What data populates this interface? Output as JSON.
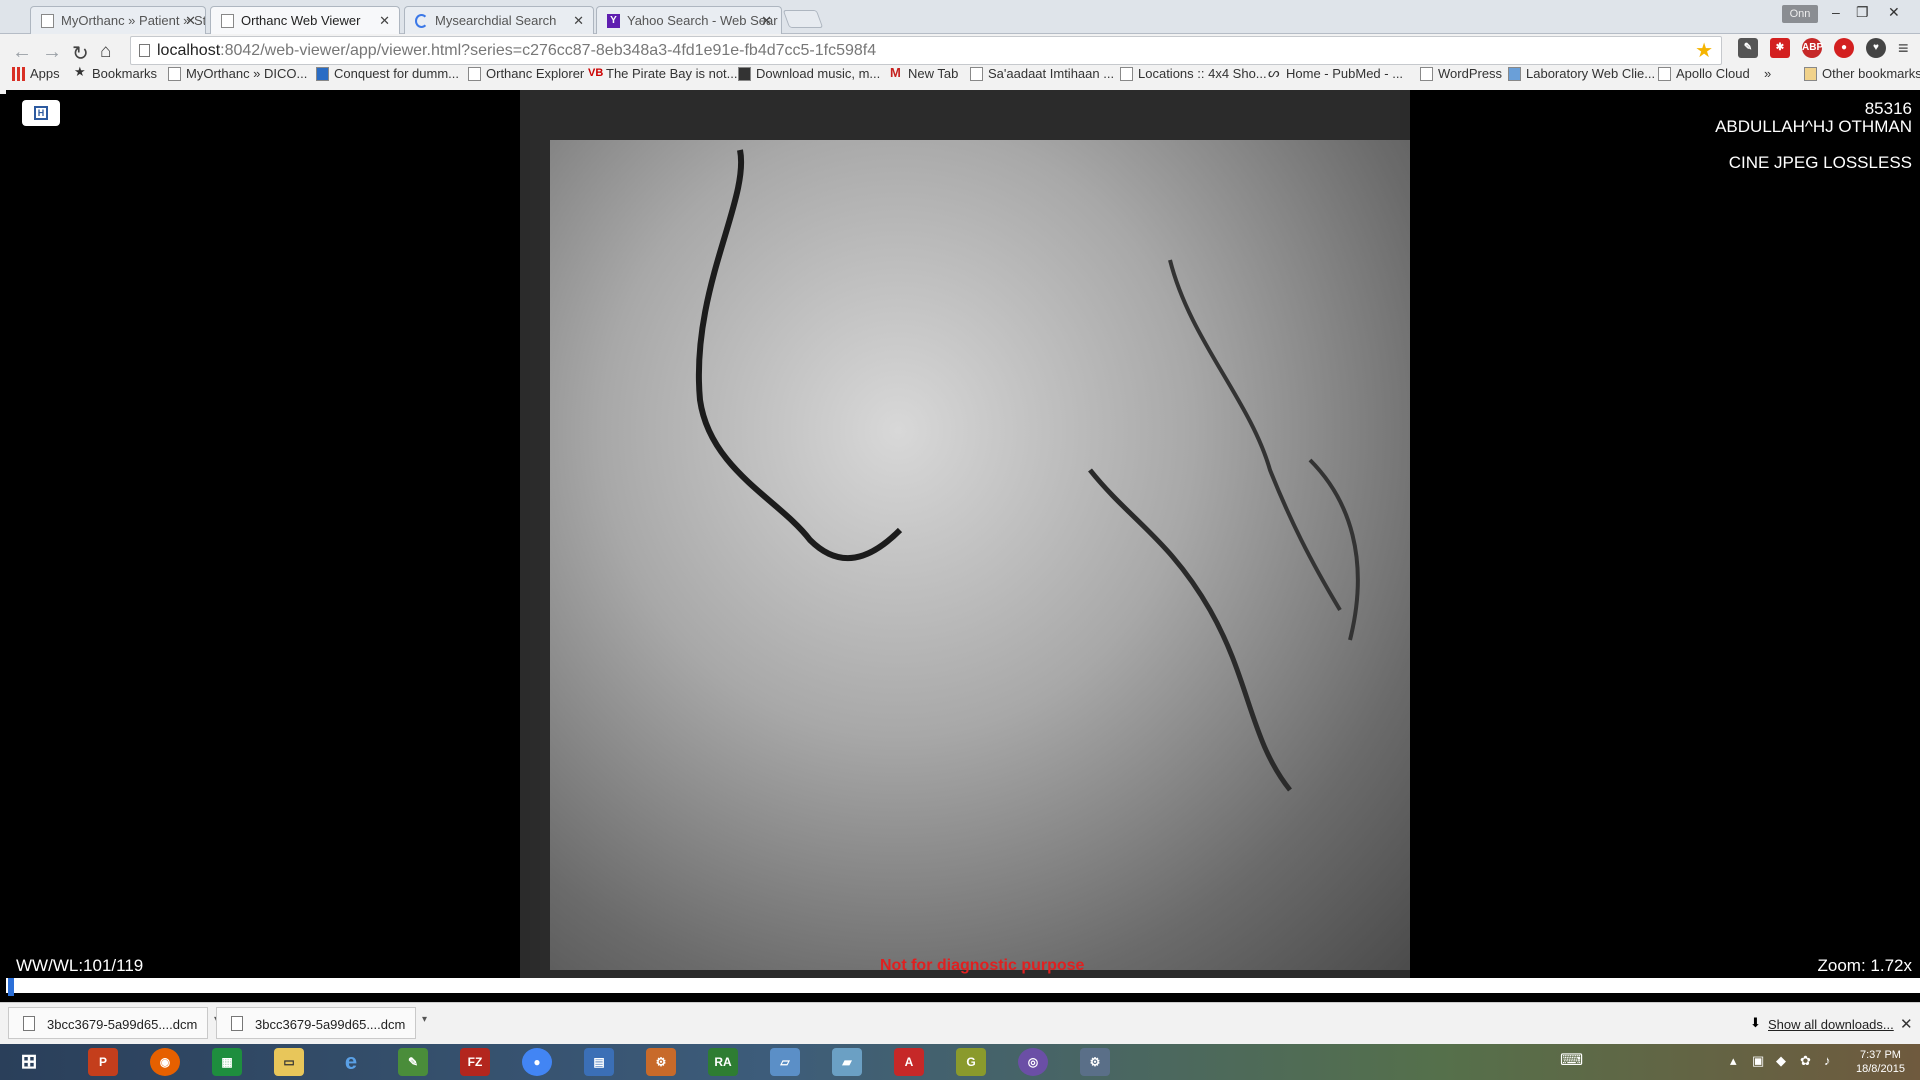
{
  "tabs": [
    {
      "label": "MyOrthanc » Patient » Stu",
      "active": false
    },
    {
      "label": "Orthanc Web Viewer",
      "active": true
    },
    {
      "label": "Mysearchdial Search",
      "active": false
    },
    {
      "label": "Yahoo Search - Web Sear",
      "active": false
    }
  ],
  "profile": "Onn",
  "address": {
    "host": "localhost",
    "rest": ":8042/web-viewer/app/viewer.html?series=c276cc87-8eb348a3-4fd1e91e-fb4d7cc5-1fc598f4"
  },
  "bookmarks": [
    "Apps",
    "Bookmarks",
    "MyOrthanc » DICO...",
    "Conquest for dumm...",
    "Orthanc Explorer",
    "The Pirate Bay is not...",
    "Download music, m...",
    "New Tab",
    "Sa'aadaat Imtihaan ...",
    "Locations :: 4x4 Sho...",
    "Home - PubMed - ...",
    "WordPress",
    "Laboratory Web Clie...",
    "Apollo Cloud",
    "»",
    "Other bookmarks"
  ],
  "viewer": {
    "patient_id": "85316",
    "patient_name": "ABDULLAH^HJ OTHMAN",
    "transfer_syntax": "CINE JPEG LOSSLESS",
    "wwwl": "WW/WL:101/119",
    "zoom": "Zoom: 1.72x",
    "disclaimer": "Not for diagnostic purpose"
  },
  "downloads": {
    "items": [
      "3bcc3679-5a99d65....dcm",
      "3bcc3679-5a99d65....dcm"
    ],
    "show_all": "Show all downloads..."
  },
  "clock": {
    "time": "7:37 PM",
    "date": "18/8/2015"
  },
  "colors": {
    "disclaimer": "#e02020",
    "timeline_handle": "#2b6fd8"
  }
}
